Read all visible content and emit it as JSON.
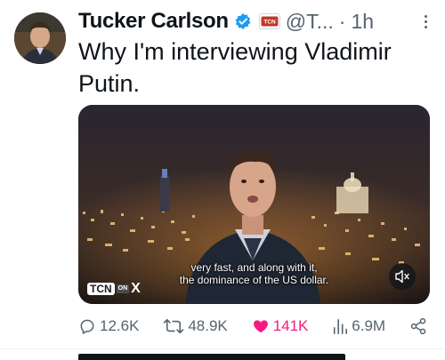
{
  "tweet": {
    "author": {
      "display_name": "Tucker Carlson",
      "handle": "@T...",
      "separator": "·",
      "time": "1h",
      "affiliate_badge": "TCN"
    },
    "text_line1": "Why I'm interviewing Vladimir",
    "text_line2": "Putin.",
    "media": {
      "caption_line1": "very fast, and along with it,",
      "caption_line2": "the dominance of the US dollar.",
      "watermark_tcn": "TCN",
      "watermark_on": "ON",
      "watermark_x": "X"
    },
    "stats": {
      "replies": "12.6K",
      "reposts": "48.9K",
      "likes": "141K",
      "views": "6.9M"
    }
  },
  "colors": {
    "accent_verified": "#1d9bf0",
    "like": "#f91880",
    "muted_text": "#536471",
    "text": "#0f1419"
  },
  "icons": [
    "verified-icon",
    "affiliate-badge-icon",
    "more-icon",
    "mute-icon",
    "reply-icon",
    "repost-icon",
    "like-icon",
    "views-icon",
    "share-icon"
  ]
}
